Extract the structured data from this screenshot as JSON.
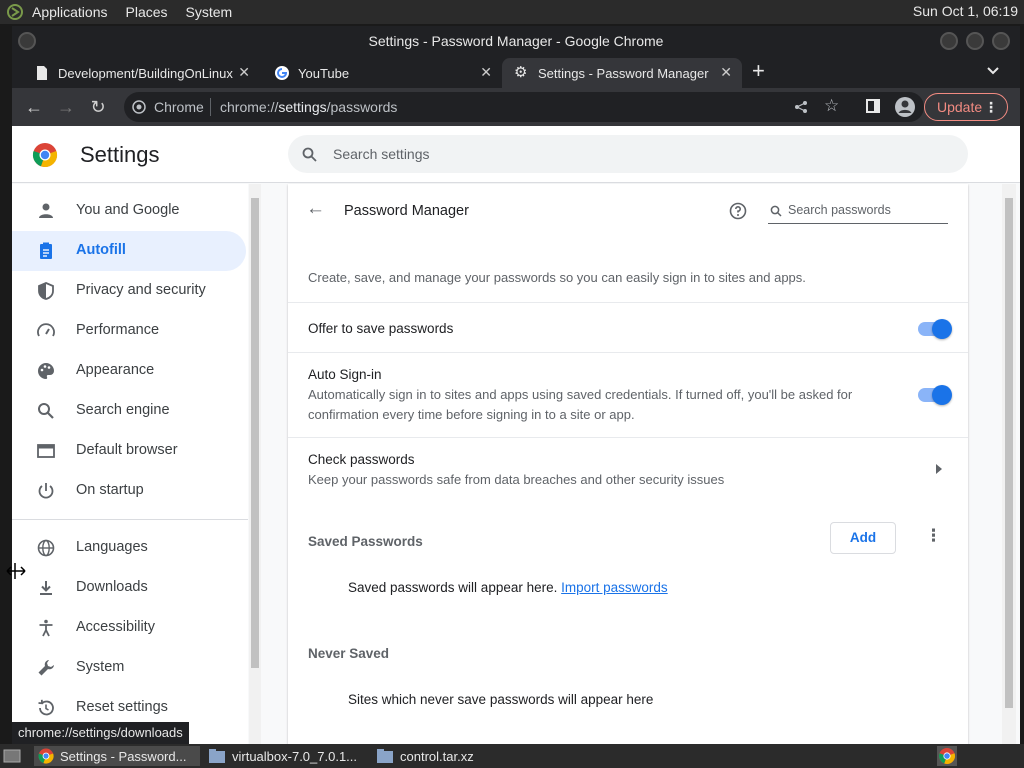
{
  "desktop": {
    "menus": [
      "Applications",
      "Places",
      "System"
    ],
    "clock": "Sun Oct 1, 06:19"
  },
  "window": {
    "title": "Settings - Password Manager - Google Chrome"
  },
  "tabs": [
    {
      "label": "Development/BuildingOnLinux"
    },
    {
      "label": "YouTube"
    },
    {
      "label": "Settings - Password Manager"
    }
  ],
  "toolbar": {
    "chip": "Chrome",
    "url_prefix": "chrome://",
    "url_host": "settings",
    "url_path": "/passwords",
    "update_label": "Update"
  },
  "settings": {
    "title": "Settings",
    "search_placeholder": "Search settings"
  },
  "sidebar": {
    "items": [
      {
        "label": "You and Google"
      },
      {
        "label": "Autofill"
      },
      {
        "label": "Privacy and security"
      },
      {
        "label": "Performance"
      },
      {
        "label": "Appearance"
      },
      {
        "label": "Search engine"
      },
      {
        "label": "Default browser"
      },
      {
        "label": "On startup"
      },
      {
        "label": "Languages"
      },
      {
        "label": "Downloads"
      },
      {
        "label": "Accessibility"
      },
      {
        "label": "System"
      },
      {
        "label": "Reset settings"
      }
    ]
  },
  "password_manager": {
    "title": "Password Manager",
    "search_placeholder": "Search passwords",
    "description": "Create, save, and manage your passwords so you can easily sign in to sites and apps.",
    "offer_to_save": "Offer to save passwords",
    "auto_signin_title": "Auto Sign-in",
    "auto_signin_desc": "Automatically sign in to sites and apps using saved credentials. If turned off, you'll be asked for confirmation every time before signing in to a site or app.",
    "check_title": "Check passwords",
    "check_desc": "Keep your passwords safe from data breaches and other security issues",
    "saved_heading": "Saved Passwords",
    "add_label": "Add",
    "saved_empty": "Saved passwords will appear here.",
    "import_link": "Import passwords",
    "never_heading": "Never Saved",
    "never_empty": "Sites which never save passwords will appear here"
  },
  "status_url": "chrome://settings/downloads",
  "taskbar": {
    "items": [
      {
        "label": "Settings - Password..."
      },
      {
        "label": "virtualbox-7.0_7.0.1..."
      },
      {
        "label": "control.tar.xz"
      }
    ]
  },
  "colors": {
    "accent": "#1a73e8",
    "update": "#f28b82"
  }
}
